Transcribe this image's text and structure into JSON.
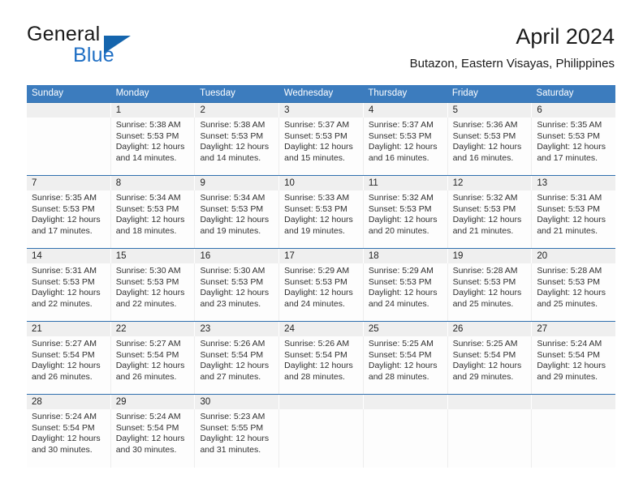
{
  "brand": {
    "name_dark": "General",
    "name_blue": "Blue",
    "accent_color": "#1565ad"
  },
  "header": {
    "title": "April 2024",
    "subtitle": "Butazon, Eastern Visayas, Philippines",
    "header_bg_color": "#3c7cbe",
    "week_divider_color": "#2f6fae",
    "daynum_bg_color": "#efefef"
  },
  "calendar": {
    "weekday_headers": [
      "Sunday",
      "Monday",
      "Tuesday",
      "Wednesday",
      "Thursday",
      "Friday",
      "Saturday"
    ],
    "weeks": [
      [
        {
          "day": "",
          "sunrise": "",
          "sunset": "",
          "daylight_line1": "",
          "daylight_line2": ""
        },
        {
          "day": "1",
          "sunrise": "Sunrise: 5:38 AM",
          "sunset": "Sunset: 5:53 PM",
          "daylight_line1": "Daylight: 12 hours",
          "daylight_line2": "and 14 minutes."
        },
        {
          "day": "2",
          "sunrise": "Sunrise: 5:38 AM",
          "sunset": "Sunset: 5:53 PM",
          "daylight_line1": "Daylight: 12 hours",
          "daylight_line2": "and 14 minutes."
        },
        {
          "day": "3",
          "sunrise": "Sunrise: 5:37 AM",
          "sunset": "Sunset: 5:53 PM",
          "daylight_line1": "Daylight: 12 hours",
          "daylight_line2": "and 15 minutes."
        },
        {
          "day": "4",
          "sunrise": "Sunrise: 5:37 AM",
          "sunset": "Sunset: 5:53 PM",
          "daylight_line1": "Daylight: 12 hours",
          "daylight_line2": "and 16 minutes."
        },
        {
          "day": "5",
          "sunrise": "Sunrise: 5:36 AM",
          "sunset": "Sunset: 5:53 PM",
          "daylight_line1": "Daylight: 12 hours",
          "daylight_line2": "and 16 minutes."
        },
        {
          "day": "6",
          "sunrise": "Sunrise: 5:35 AM",
          "sunset": "Sunset: 5:53 PM",
          "daylight_line1": "Daylight: 12 hours",
          "daylight_line2": "and 17 minutes."
        }
      ],
      [
        {
          "day": "7",
          "sunrise": "Sunrise: 5:35 AM",
          "sunset": "Sunset: 5:53 PM",
          "daylight_line1": "Daylight: 12 hours",
          "daylight_line2": "and 17 minutes."
        },
        {
          "day": "8",
          "sunrise": "Sunrise: 5:34 AM",
          "sunset": "Sunset: 5:53 PM",
          "daylight_line1": "Daylight: 12 hours",
          "daylight_line2": "and 18 minutes."
        },
        {
          "day": "9",
          "sunrise": "Sunrise: 5:34 AM",
          "sunset": "Sunset: 5:53 PM",
          "daylight_line1": "Daylight: 12 hours",
          "daylight_line2": "and 19 minutes."
        },
        {
          "day": "10",
          "sunrise": "Sunrise: 5:33 AM",
          "sunset": "Sunset: 5:53 PM",
          "daylight_line1": "Daylight: 12 hours",
          "daylight_line2": "and 19 minutes."
        },
        {
          "day": "11",
          "sunrise": "Sunrise: 5:32 AM",
          "sunset": "Sunset: 5:53 PM",
          "daylight_line1": "Daylight: 12 hours",
          "daylight_line2": "and 20 minutes."
        },
        {
          "day": "12",
          "sunrise": "Sunrise: 5:32 AM",
          "sunset": "Sunset: 5:53 PM",
          "daylight_line1": "Daylight: 12 hours",
          "daylight_line2": "and 21 minutes."
        },
        {
          "day": "13",
          "sunrise": "Sunrise: 5:31 AM",
          "sunset": "Sunset: 5:53 PM",
          "daylight_line1": "Daylight: 12 hours",
          "daylight_line2": "and 21 minutes."
        }
      ],
      [
        {
          "day": "14",
          "sunrise": "Sunrise: 5:31 AM",
          "sunset": "Sunset: 5:53 PM",
          "daylight_line1": "Daylight: 12 hours",
          "daylight_line2": "and 22 minutes."
        },
        {
          "day": "15",
          "sunrise": "Sunrise: 5:30 AM",
          "sunset": "Sunset: 5:53 PM",
          "daylight_line1": "Daylight: 12 hours",
          "daylight_line2": "and 22 minutes."
        },
        {
          "day": "16",
          "sunrise": "Sunrise: 5:30 AM",
          "sunset": "Sunset: 5:53 PM",
          "daylight_line1": "Daylight: 12 hours",
          "daylight_line2": "and 23 minutes."
        },
        {
          "day": "17",
          "sunrise": "Sunrise: 5:29 AM",
          "sunset": "Sunset: 5:53 PM",
          "daylight_line1": "Daylight: 12 hours",
          "daylight_line2": "and 24 minutes."
        },
        {
          "day": "18",
          "sunrise": "Sunrise: 5:29 AM",
          "sunset": "Sunset: 5:53 PM",
          "daylight_line1": "Daylight: 12 hours",
          "daylight_line2": "and 24 minutes."
        },
        {
          "day": "19",
          "sunrise": "Sunrise: 5:28 AM",
          "sunset": "Sunset: 5:53 PM",
          "daylight_line1": "Daylight: 12 hours",
          "daylight_line2": "and 25 minutes."
        },
        {
          "day": "20",
          "sunrise": "Sunrise: 5:28 AM",
          "sunset": "Sunset: 5:53 PM",
          "daylight_line1": "Daylight: 12 hours",
          "daylight_line2": "and 25 minutes."
        }
      ],
      [
        {
          "day": "21",
          "sunrise": "Sunrise: 5:27 AM",
          "sunset": "Sunset: 5:54 PM",
          "daylight_line1": "Daylight: 12 hours",
          "daylight_line2": "and 26 minutes."
        },
        {
          "day": "22",
          "sunrise": "Sunrise: 5:27 AM",
          "sunset": "Sunset: 5:54 PM",
          "daylight_line1": "Daylight: 12 hours",
          "daylight_line2": "and 26 minutes."
        },
        {
          "day": "23",
          "sunrise": "Sunrise: 5:26 AM",
          "sunset": "Sunset: 5:54 PM",
          "daylight_line1": "Daylight: 12 hours",
          "daylight_line2": "and 27 minutes."
        },
        {
          "day": "24",
          "sunrise": "Sunrise: 5:26 AM",
          "sunset": "Sunset: 5:54 PM",
          "daylight_line1": "Daylight: 12 hours",
          "daylight_line2": "and 28 minutes."
        },
        {
          "day": "25",
          "sunrise": "Sunrise: 5:25 AM",
          "sunset": "Sunset: 5:54 PM",
          "daylight_line1": "Daylight: 12 hours",
          "daylight_line2": "and 28 minutes."
        },
        {
          "day": "26",
          "sunrise": "Sunrise: 5:25 AM",
          "sunset": "Sunset: 5:54 PM",
          "daylight_line1": "Daylight: 12 hours",
          "daylight_line2": "and 29 minutes."
        },
        {
          "day": "27",
          "sunrise": "Sunrise: 5:24 AM",
          "sunset": "Sunset: 5:54 PM",
          "daylight_line1": "Daylight: 12 hours",
          "daylight_line2": "and 29 minutes."
        }
      ],
      [
        {
          "day": "28",
          "sunrise": "Sunrise: 5:24 AM",
          "sunset": "Sunset: 5:54 PM",
          "daylight_line1": "Daylight: 12 hours",
          "daylight_line2": "and 30 minutes."
        },
        {
          "day": "29",
          "sunrise": "Sunrise: 5:24 AM",
          "sunset": "Sunset: 5:54 PM",
          "daylight_line1": "Daylight: 12 hours",
          "daylight_line2": "and 30 minutes."
        },
        {
          "day": "30",
          "sunrise": "Sunrise: 5:23 AM",
          "sunset": "Sunset: 5:55 PM",
          "daylight_line1": "Daylight: 12 hours",
          "daylight_line2": "and 31 minutes."
        },
        {
          "day": "",
          "sunrise": "",
          "sunset": "",
          "daylight_line1": "",
          "daylight_line2": ""
        },
        {
          "day": "",
          "sunrise": "",
          "sunset": "",
          "daylight_line1": "",
          "daylight_line2": ""
        },
        {
          "day": "",
          "sunrise": "",
          "sunset": "",
          "daylight_line1": "",
          "daylight_line2": ""
        },
        {
          "day": "",
          "sunrise": "",
          "sunset": "",
          "daylight_line1": "",
          "daylight_line2": ""
        }
      ]
    ]
  }
}
